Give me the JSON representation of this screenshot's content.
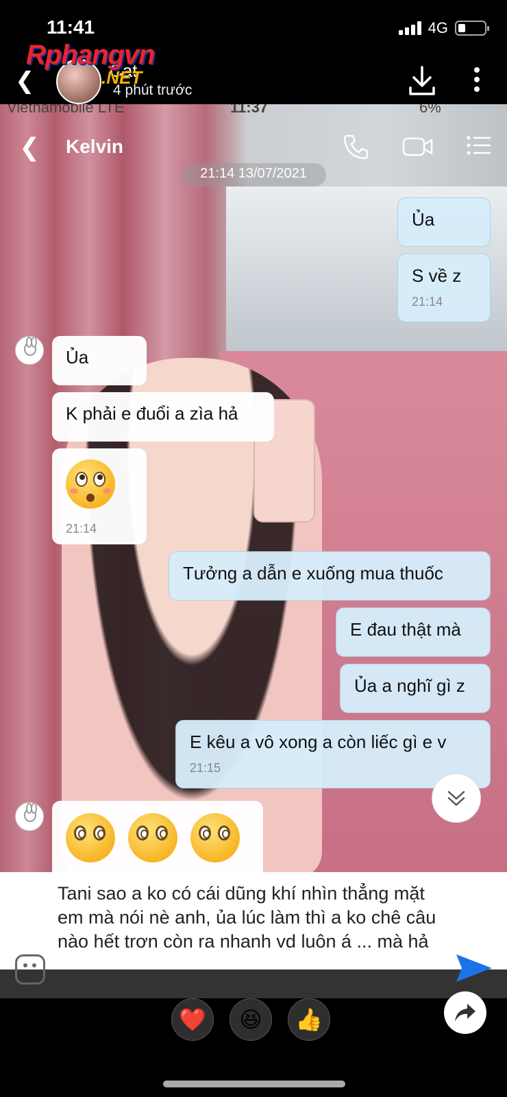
{
  "status_bar": {
    "time": "11:41",
    "network": "4G"
  },
  "story": {
    "logo_text": "Rphangvn",
    "logo_suffix": ".NET",
    "name": "Cat",
    "posted": "4 phút trước",
    "download_icon": "download-icon",
    "more_icon": "more-vertical-icon"
  },
  "inner_status": {
    "carrier": "Vietnamobile  LTE",
    "time": "11:37",
    "battery": "6%"
  },
  "chat": {
    "contact_name": "Kelvin",
    "date_divider": "21:14 13/07/2021",
    "messages": [
      {
        "side": "out",
        "text": "Ủa",
        "time": ""
      },
      {
        "side": "out",
        "text": "S về z",
        "time": "21:14"
      },
      {
        "side": "in",
        "text": "Ủa",
        "time": ""
      },
      {
        "side": "in",
        "text": "K phải e đuổi a zìa hả",
        "time": ""
      },
      {
        "side": "in",
        "text": "",
        "emoji": "flushed-face",
        "time": "21:14"
      },
      {
        "side": "out",
        "text": "Tưởng a dẫn e xuống mua thuốc",
        "time": ""
      },
      {
        "side": "out",
        "text": "E đau thật mà",
        "time": ""
      },
      {
        "side": "out",
        "text": "Ủa a nghĩ gì z",
        "time": ""
      },
      {
        "side": "out",
        "text": "E kêu a vô xong a còn liếc gì e v",
        "time": "21:15"
      },
      {
        "side": "in",
        "text": "",
        "emoji": "dizzy-face x3",
        "time": ""
      }
    ]
  },
  "caption": {
    "text": "Tani sao a ko có cái dũng khí nhìn thẳng  mặt em mà nói nè anh, ủa lúc làm thì a ko chê câu nào hết trơn còn ra nhanh vd luôn á ... mà hả"
  },
  "reactions": [
    {
      "icon": "heart-icon",
      "glyph": "❤️"
    },
    {
      "icon": "laughing-face-icon",
      "glyph": "😆"
    },
    {
      "icon": "thumbs-up-icon",
      "glyph": "👍"
    }
  ],
  "colors": {
    "outgoing_bubble": "#d6ecfa",
    "incoming_bubble": "#ffffff",
    "send_blue": "#1a73e8",
    "logo_red": "#e8262c",
    "logo_gold": "#f7b500"
  }
}
